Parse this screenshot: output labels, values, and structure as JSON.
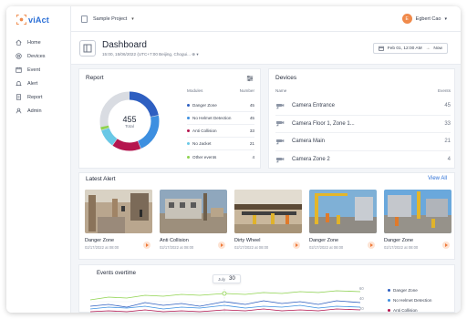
{
  "app": {
    "logo_text": "viAct"
  },
  "topbar": {
    "project": "Sample Project",
    "user_initial": "E",
    "user_name": "Egbert Cao"
  },
  "sidebar": {
    "items": [
      {
        "label": "Home",
        "icon": "home-icon"
      },
      {
        "label": "Devices",
        "icon": "camera-icon"
      },
      {
        "label": "Event",
        "icon": "event-icon"
      },
      {
        "label": "Alert",
        "icon": "alert-icon"
      },
      {
        "label": "Report",
        "icon": "report-icon"
      },
      {
        "label": "Admin",
        "icon": "admin-icon"
      }
    ]
  },
  "dashboard": {
    "title": "Dashboard",
    "subtitle": "15:00, 15/06/2022 (UTC+7:00 Beijing, Chogui...",
    "date_start": "Feb 01, 12:00 AM",
    "date_end": "Now"
  },
  "report": {
    "title": "Report",
    "total_value": "455",
    "total_label": "Total",
    "col_modules": "Modules",
    "col_number": "Number",
    "modules": [
      {
        "label": "Danger Zone",
        "value": "45",
        "color": "#2e5fc1"
      },
      {
        "label": "No Helmet Detection",
        "value": "45",
        "color": "#3d8fe0"
      },
      {
        "label": "Anti Collision",
        "value": "33",
        "color": "#b5164f"
      },
      {
        "label": "No Jacket",
        "value": "21",
        "color": "#69c8e6"
      },
      {
        "label": "Other events",
        "value": "4",
        "color": "#8fd34f"
      }
    ],
    "remainder_color": "#d9dce2"
  },
  "devices": {
    "title": "Devices",
    "col_name": "Name",
    "col_events": "Events",
    "items": [
      {
        "name": "Camera Entrance",
        "events": "45"
      },
      {
        "name": "Camera Floor 1, Zone 1...",
        "events": "33"
      },
      {
        "name": "Camera Main",
        "events": "21"
      },
      {
        "name": "Camera Zone 2",
        "events": "4"
      }
    ]
  },
  "latest_alert": {
    "title": "Latest Alert",
    "view_all": "View All",
    "items": [
      {
        "name": "Danger Zone",
        "time": "02/17/2022 at 08:00"
      },
      {
        "name": "Anti Collision",
        "time": "02/17/2022 at 08:00"
      },
      {
        "name": "Dirty Wheel",
        "time": "02/17/2022 at 08:00"
      },
      {
        "name": "Danger Zone",
        "time": "02/17/2022 at 08:00"
      },
      {
        "name": "Danger Zone",
        "time": "02/17/2022 at 08:00"
      }
    ]
  },
  "events_overtime": {
    "title": "Events overtime",
    "tooltip_label": "July",
    "tooltip_value": "30",
    "axis_ticks": [
      "60",
      "40",
      "20"
    ],
    "legend": [
      {
        "label": "Danger Zone",
        "color": "#2e5fc1"
      },
      {
        "label": "No Helmet Detection",
        "color": "#3d8fe0"
      },
      {
        "label": "Anti Collision",
        "color": "#b5164f"
      }
    ]
  }
}
